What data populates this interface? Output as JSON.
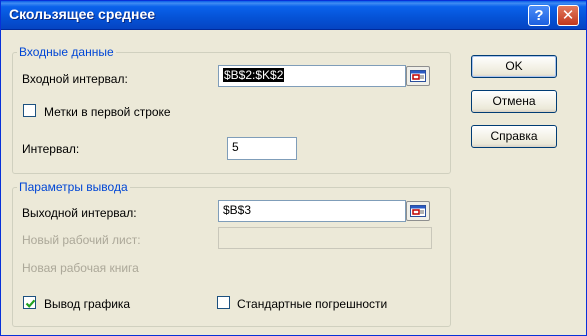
{
  "window": {
    "title": "Скользящее среднее",
    "help_glyph": "?",
    "close_glyph": "✕"
  },
  "input_group": {
    "legend": "Входные данные",
    "input_range_label": "Входной интервал:",
    "input_range_value": "$B$2:$K$2",
    "labels_first_row_label": "Метки в первой строке",
    "labels_first_row_checked": false,
    "interval_label": "Интервал:",
    "interval_value": "5"
  },
  "output_group": {
    "legend": "Параметры вывода",
    "output_range_label": "Выходной интервал:",
    "output_range_value": "$B$3",
    "new_sheet_label": "Новый рабочий лист:",
    "new_sheet_value": "",
    "new_workbook_label": "Новая рабочая книга",
    "chart_output_label": "Вывод графика",
    "chart_output_checked": true,
    "std_errors_label": "Стандартные погрешности",
    "std_errors_checked": false
  },
  "buttons": {
    "ok": "OK",
    "cancel": "Отмена",
    "help": "Справка"
  },
  "colors": {
    "titlebar": "#0552d6",
    "legend_text": "#0046d5",
    "check_mark": "#21a121",
    "dialog_bg": "#ece9d8"
  }
}
